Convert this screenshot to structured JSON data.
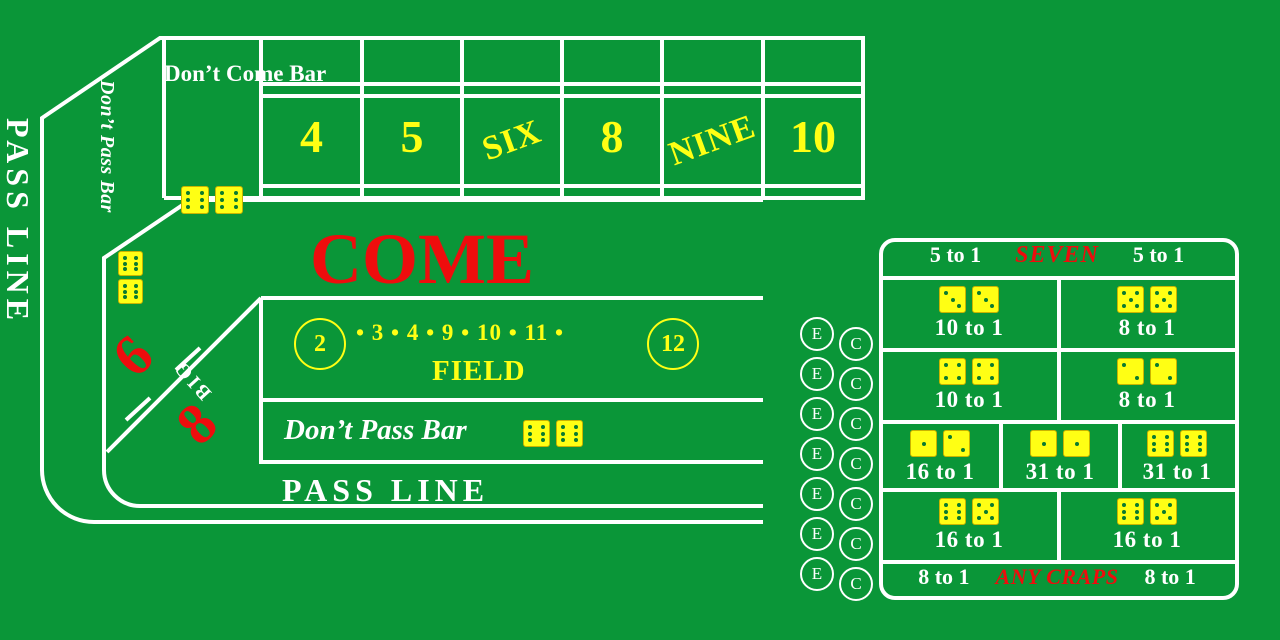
{
  "colors": {
    "felt": "#0a9638",
    "line": "#ffffff",
    "yellow": "#ffff14",
    "red": "#ee0d0d",
    "pip": "#0a7a30"
  },
  "table": {
    "pass_line_left_label": "PASS LINE",
    "pass_line_bottom_label": "PASS LINE",
    "dont_pass_bar_side_label": "Don’t Pass Bar",
    "dont_pass_bar_side_dice": [
      6,
      6
    ],
    "dont_come_bar_label": "Don’t Come Bar",
    "dont_come_bar_dice": [
      6,
      6
    ],
    "come_label": "COME",
    "dont_pass_bar_row_label": "Don’t Pass Bar",
    "dont_pass_bar_row_dice": [
      6,
      6
    ],
    "point_numbers": [
      {
        "label": "4",
        "rotated": false
      },
      {
        "label": "5",
        "rotated": false
      },
      {
        "label": "SIX",
        "rotated": true
      },
      {
        "label": "8",
        "rotated": false
      },
      {
        "label": "NINE",
        "rotated": true
      },
      {
        "label": "10",
        "rotated": false
      }
    ],
    "field": {
      "word": "FIELD",
      "left_circle": "2",
      "right_circle": "12",
      "numbers_line": "• 3 • 4 • 9 • 10 • 11 •"
    },
    "big_bets": {
      "word": "BIG",
      "six": "6",
      "eight": "8"
    }
  },
  "ec_circles": {
    "e_label": "E",
    "c_label": "C",
    "count": 7
  },
  "proposition": {
    "top_row": {
      "left_odds": "5 to 1",
      "center_label": "SEVEN",
      "right_odds": "5 to 1"
    },
    "hardways": [
      {
        "name": "hard-six",
        "dice": [
          3,
          3
        ],
        "odds": "10 to 1"
      },
      {
        "name": "hard-ten",
        "dice": [
          5,
          5
        ],
        "odds": "8 to 1"
      },
      {
        "name": "hard-eight",
        "dice": [
          4,
          4
        ],
        "odds": "10 to 1"
      },
      {
        "name": "hard-four",
        "dice": [
          2,
          2
        ],
        "odds": "8 to 1"
      }
    ],
    "singles": [
      {
        "name": "three",
        "dice": [
          1,
          2
        ],
        "odds": "16 to 1"
      },
      {
        "name": "two",
        "dice": [
          1,
          1
        ],
        "odds": "31 to 1"
      },
      {
        "name": "twelve",
        "dice": [
          6,
          6
        ],
        "odds": "31 to 1"
      }
    ],
    "elevens": [
      {
        "name": "eleven-left",
        "dice": [
          6,
          5
        ],
        "odds": "16 to 1"
      },
      {
        "name": "eleven-right",
        "dice": [
          6,
          5
        ],
        "odds": "16 to 1"
      }
    ],
    "bottom_row": {
      "left_odds": "8 to 1",
      "center_label": "ANY CRAPS",
      "right_odds": "8 to 1"
    }
  }
}
